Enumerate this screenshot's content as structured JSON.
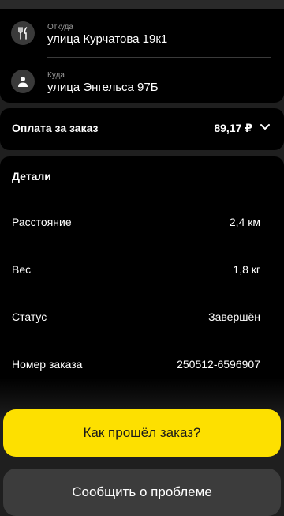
{
  "route": {
    "from": {
      "label": "Откуда",
      "address": "улица Курчатова 19к1",
      "icon": "fork-knife-icon"
    },
    "to": {
      "label": "Куда",
      "address": "улица Энгельса 97Б",
      "icon": "person-icon"
    }
  },
  "payment": {
    "label": "Оплата за заказ",
    "amount": "89,17 ₽",
    "icon": "chevron-down-icon"
  },
  "details": {
    "title": "Детали",
    "rows": [
      {
        "label": "Расстояние",
        "value": "2,4 км"
      },
      {
        "label": "Вес",
        "value": "1,8 кг"
      },
      {
        "label": "Статус",
        "value": "Завершён"
      },
      {
        "label": "Номер заказа",
        "value": "250512-6596907"
      }
    ]
  },
  "actions": {
    "primary_label": "Как прошёл заказ?",
    "secondary_label": "Сообщить о проблеме"
  },
  "colors": {
    "accent": "#fde000",
    "background": "#000000"
  }
}
